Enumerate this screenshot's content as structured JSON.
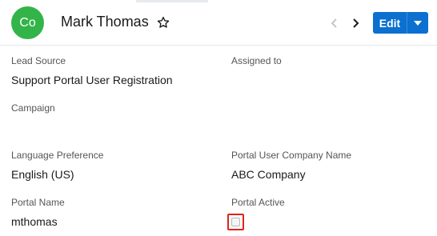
{
  "header": {
    "avatar_initials": "Co",
    "record_name": "Mark Thomas",
    "edit_label": "Edit"
  },
  "fields": {
    "lead_source": {
      "label": "Lead Source",
      "value": "Support Portal User Registration"
    },
    "assigned_to": {
      "label": "Assigned to",
      "value": ""
    },
    "campaign": {
      "label": "Campaign",
      "value": ""
    },
    "language_preference": {
      "label": "Language Preference",
      "value": "English (US)"
    },
    "portal_user_company_name": {
      "label": "Portal User Company Name",
      "value": "ABC Company"
    },
    "portal_name": {
      "label": "Portal Name",
      "value": "mthomas"
    },
    "portal_active": {
      "label": "Portal Active",
      "checked": false
    }
  },
  "colors": {
    "avatar": "#33b449",
    "primary_button": "#0b70cf",
    "highlight": "#e2231a"
  },
  "icons": {
    "favorite": "star-outline-icon",
    "previous": "chevron-left-icon",
    "next": "chevron-right-icon",
    "actions": "caret-down-icon"
  }
}
